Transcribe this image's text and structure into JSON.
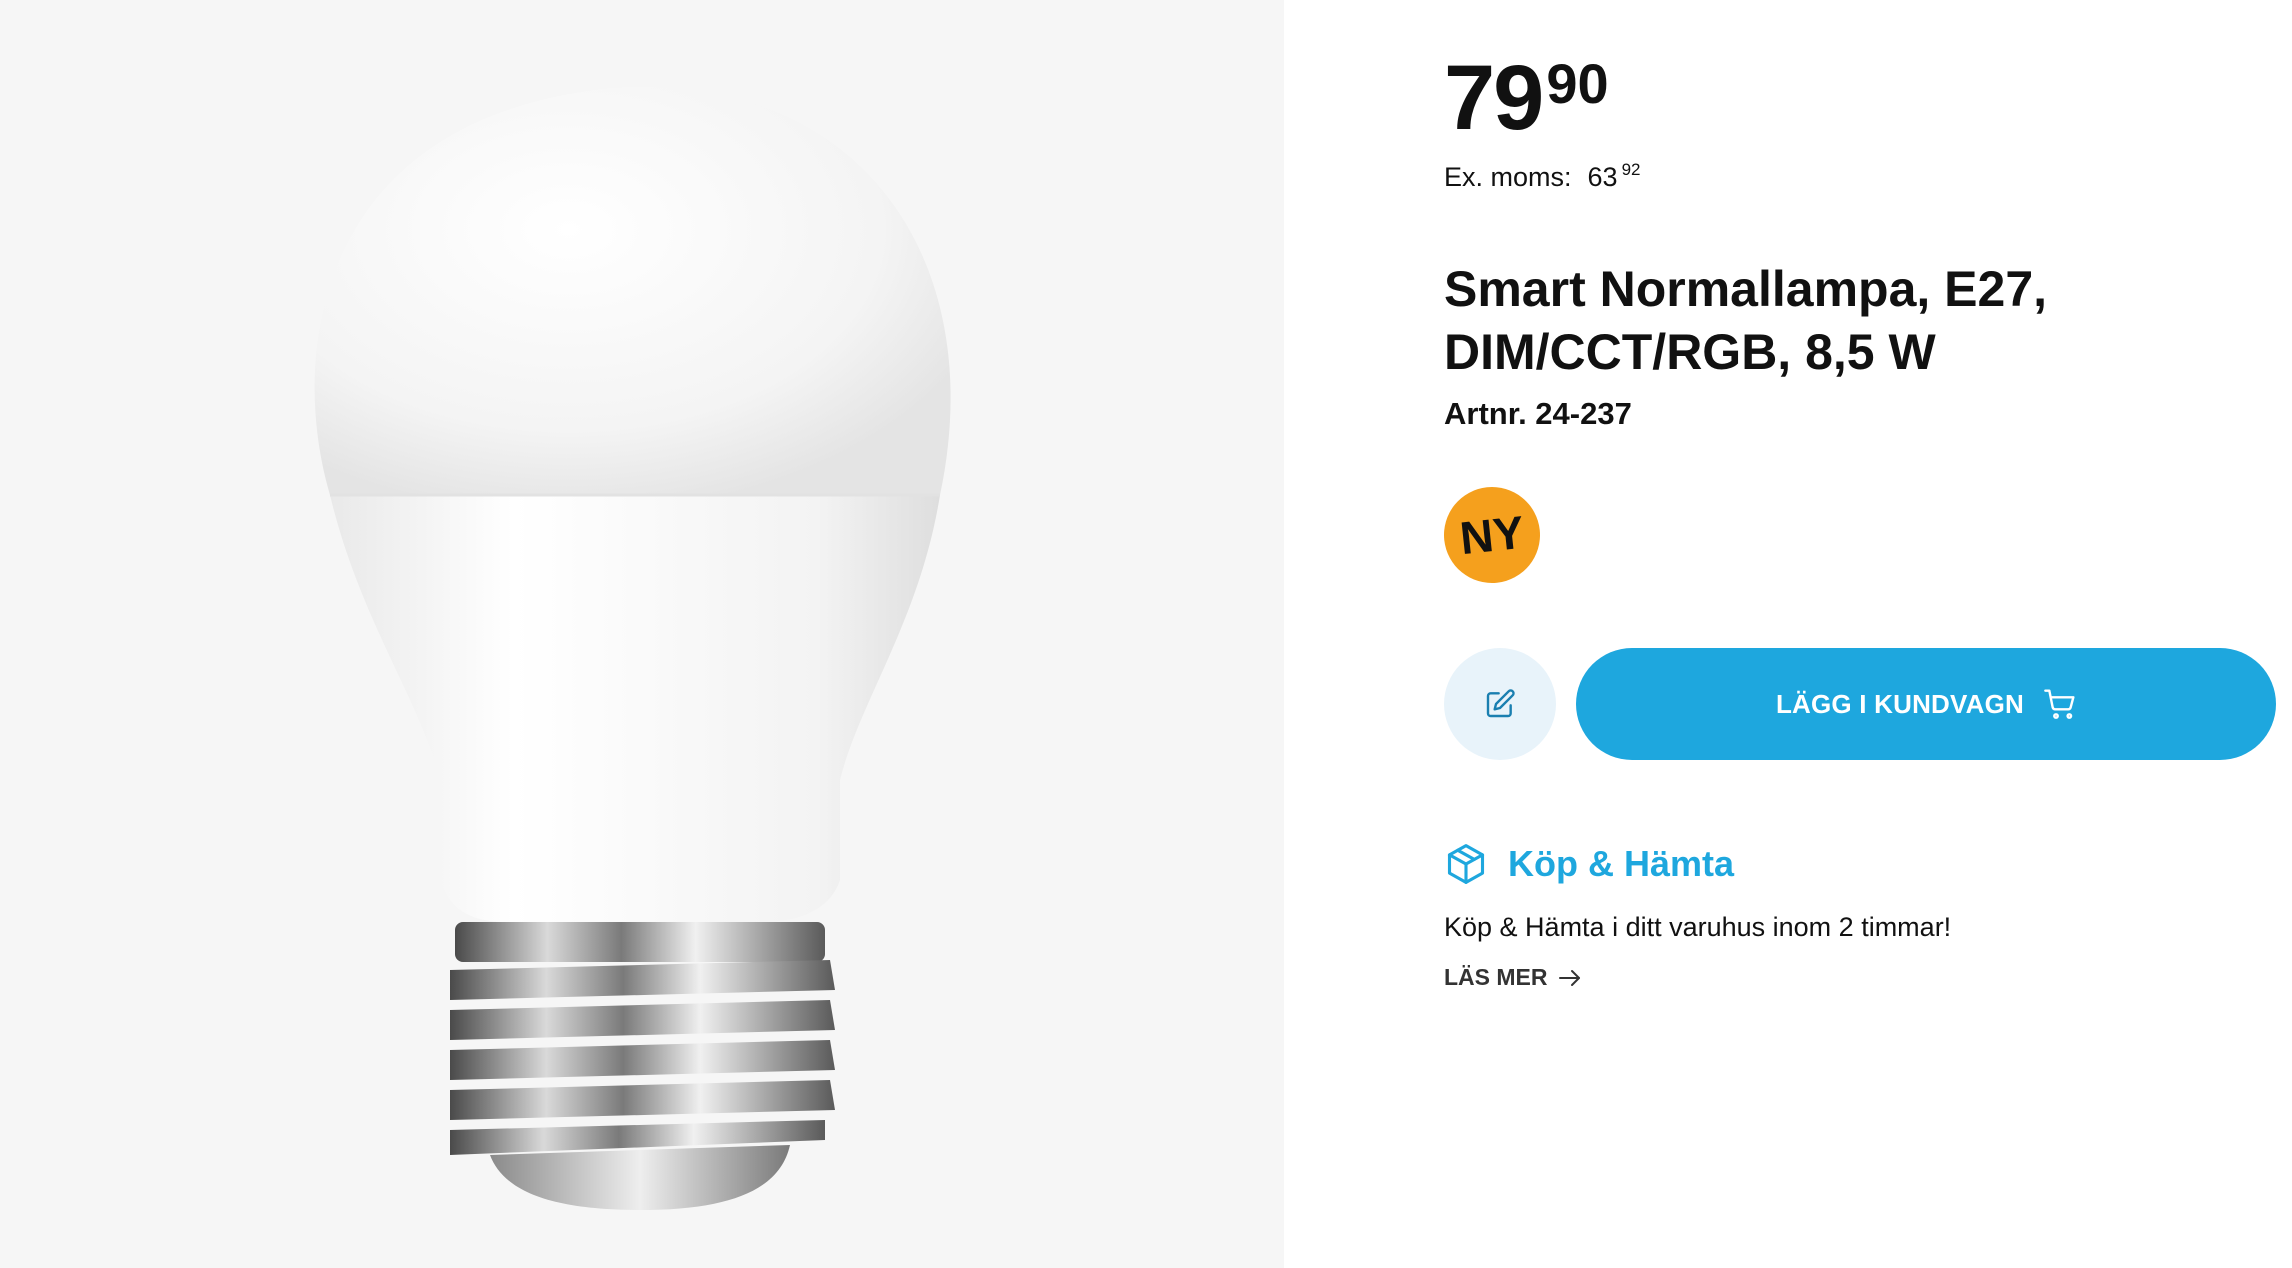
{
  "product": {
    "price": {
      "integer": "79",
      "decimals": "90"
    },
    "ex_moms": {
      "label": "Ex. moms:",
      "integer": "63",
      "decimals": "92"
    },
    "title_line1": "Smart Normallampa, E27,",
    "title_line2": "DIM/CCT/RGB, 8,5 W",
    "article_number": "Artnr. 24-237",
    "badge": "NY"
  },
  "actions": {
    "add_to_cart_label": "LÄGG I KUNDVAGN",
    "edit_icon": "edit-icon",
    "cart_icon": "cart-icon"
  },
  "pickup": {
    "icon": "box-icon",
    "title": "Köp & Hämta",
    "description": "Köp & Hämta i ditt varuhus inom 2 timmar!",
    "read_more": "LÄS MER"
  },
  "colors": {
    "accent": "#1ea7de",
    "badge": "#f5a01d",
    "edit_button_bg": "#e8f3fa",
    "image_bg": "#f6f6f6"
  }
}
